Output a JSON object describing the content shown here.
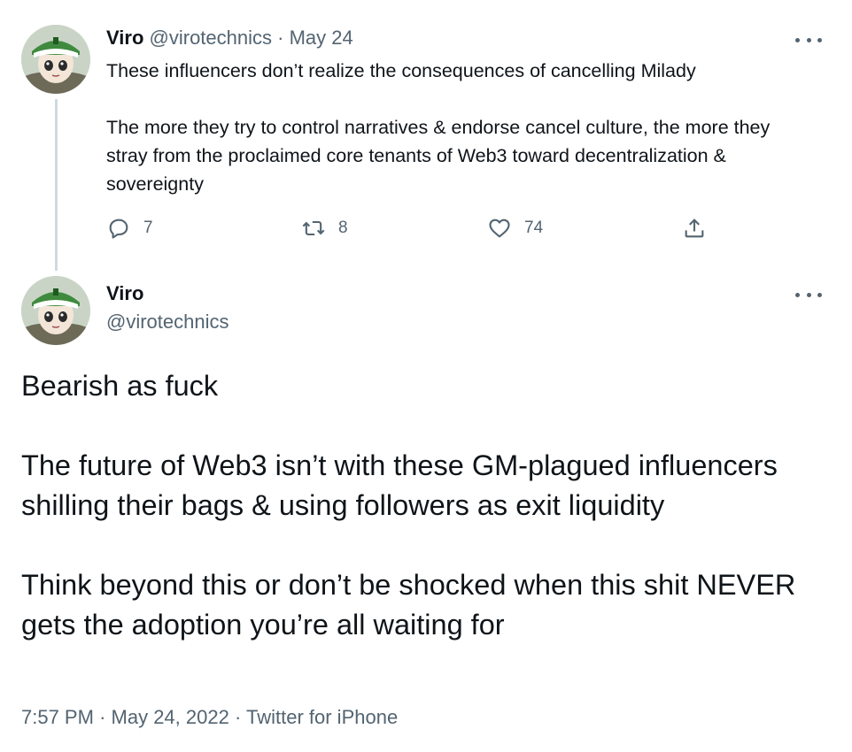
{
  "tweet1": {
    "author_name": "Viro",
    "author_handle": "@virotechnics",
    "separator": "·",
    "date": "May 24",
    "paragraphs": [
      "These influencers don’t realize the consequences of cancelling Milady",
      "The more they try to control narratives & endorse cancel culture, the more they stray from the proclaimed core tenants of Web3 toward decentralization & sovereignty"
    ],
    "actions": {
      "reply_count": "7",
      "retweet_count": "8",
      "like_count": "74"
    }
  },
  "tweet2": {
    "author_name": "Viro",
    "author_handle": "@virotechnics",
    "paragraphs": [
      "Bearish as fuck",
      "The future of Web3 isn’t with these GM-plagued influencers shilling their bags & using followers as exit liquidity",
      "Think beyond this or don’t be shocked when this shit NEVER gets the adoption you’re all waiting for"
    ],
    "time": "7:57 PM",
    "full_date": "May 24, 2022",
    "source": "Twitter for iPhone",
    "separator": "·"
  },
  "icons": {
    "more": "more-horizontal-icon",
    "reply": "reply-icon",
    "retweet": "retweet-icon",
    "like": "heart-icon",
    "share": "share-icon"
  },
  "colors": {
    "text": "#0f1419",
    "muted": "#536471",
    "thread_line": "#cfd9de",
    "background": "#ffffff"
  }
}
